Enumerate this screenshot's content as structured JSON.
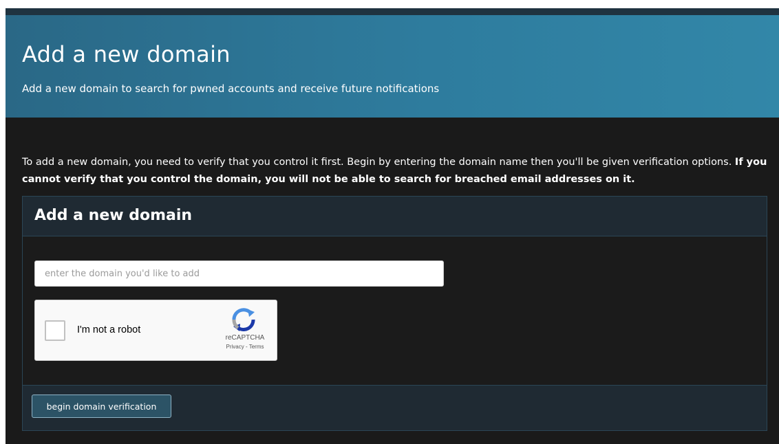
{
  "hero": {
    "title": "Add a new domain",
    "subtitle": "Add a new domain to search for pwned accounts and receive future notifications"
  },
  "intro": {
    "text": "To add a new domain, you need to verify that you control it first. Begin by entering the domain name then you'll be given verification options.",
    "bold_text": "If you cannot verify that you control the domain, you will not be able to search for breached email addresses on it."
  },
  "panel": {
    "title": "Add a new domain",
    "domain_input": {
      "value": "",
      "placeholder": "enter the domain you'd like to add"
    },
    "recaptcha": {
      "label": "I'm not a robot",
      "brand": "reCAPTCHA",
      "privacy": "Privacy",
      "separator": " - ",
      "terms": "Terms"
    },
    "button_label": "begin domain verification"
  },
  "colors": {
    "hero_start": "#2a6886",
    "hero_end": "#3287a8",
    "background": "#1a1a1a",
    "panel_header": "#1f2a33",
    "button": "#2c5366"
  },
  "icons": {
    "recaptcha_logo": "recaptcha-logo-icon",
    "checkbox": "checkbox-icon"
  }
}
